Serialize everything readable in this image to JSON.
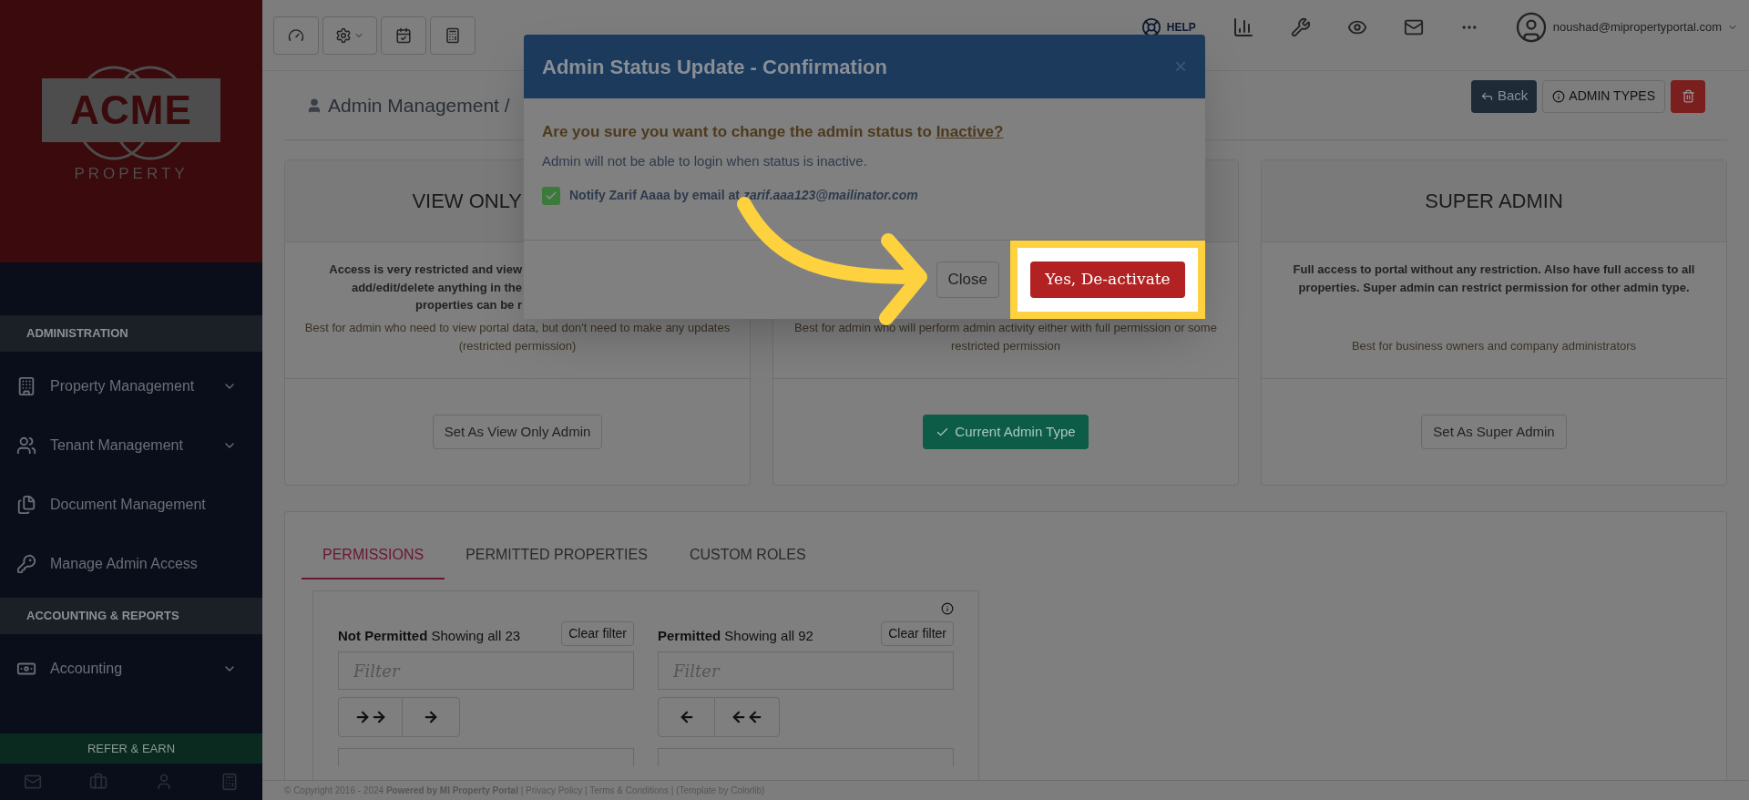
{
  "sidebar": {
    "logo": {
      "name": "ACME",
      "tagline": "PROPERTY"
    },
    "sections": [
      {
        "title": "ADMINISTRATION",
        "items": [
          {
            "label": "Property Management",
            "expandable": true
          },
          {
            "label": "Tenant Management",
            "expandable": true
          },
          {
            "label": "Document Management",
            "expandable": false
          },
          {
            "label": "Manage Admin Access",
            "expandable": false
          }
        ]
      },
      {
        "title": "ACCOUNTING & REPORTS",
        "items": [
          {
            "label": "Accounting",
            "expandable": true
          }
        ]
      }
    ],
    "refer_button": "REFER & EARN"
  },
  "topbar": {
    "help_label": "HELP",
    "user_email": "noushad@mipropertyportal.com"
  },
  "page": {
    "breadcrumb": "Admin Management /",
    "back_button": "Back",
    "types_button": "ADMIN TYPES"
  },
  "admin_types": [
    {
      "title": "VIEW ONLY",
      "description": [
        "Access is very restricted and view",
        "add/edit/delete anything in the",
        "properties can be r"
      ],
      "note": "Best for admin who need to view portal data, but don't need to make any updates (restricted permission)",
      "button": {
        "label": "Set As View Only Admin",
        "current": false
      }
    },
    {
      "note": "Best for admin who will perform admin activity either with full permission or some restricted permission",
      "button": {
        "label": "Current Admin Type",
        "current": true
      }
    },
    {
      "title": "SUPER ADMIN",
      "description": [
        "Full access to portal without any restriction. Also have full access to all properties. Super admin can restrict permission for other admin type."
      ],
      "note": "Best for business owners and company administrators",
      "button": {
        "label": "Set As Super Admin",
        "current": false
      }
    }
  ],
  "tabs": [
    {
      "label": "PERMISSIONS",
      "selected": true
    },
    {
      "label": "PERMITTED PROPERTIES",
      "selected": false
    },
    {
      "label": "CUSTOM ROLES",
      "selected": false
    }
  ],
  "lists": [
    {
      "heading": "**Not Permitted** Showing all 23",
      "clear_button": "Clear filter",
      "filter_placeholder": "Filter",
      "kind": "outgoing"
    },
    {
      "heading": "**Permitted** Showing all 92",
      "clear_button": "Clear filter",
      "filter_placeholder": "Filter",
      "kind": "incoming"
    }
  ],
  "footer": "© Copyright 2016 - 2024 **Powered by MI Property Portal** | Privacy Policy | Terms & Conditions | (Template by Colorlib)",
  "modal": {
    "title": "Admin Status Update - Confirmation",
    "close_glyph": "×",
    "question": "Are you sure you want to change the admin status to ",
    "status": "Inactive?",
    "note": "Admin will not be able to login when status is inactive.",
    "notify": {
      "checked": true,
      "text": "Notify Zarif Aaaa by email at *zarif.aaa123@mailinator.com*"
    },
    "close_button": "Close",
    "confirm_button": "Yes, De-activate"
  }
}
